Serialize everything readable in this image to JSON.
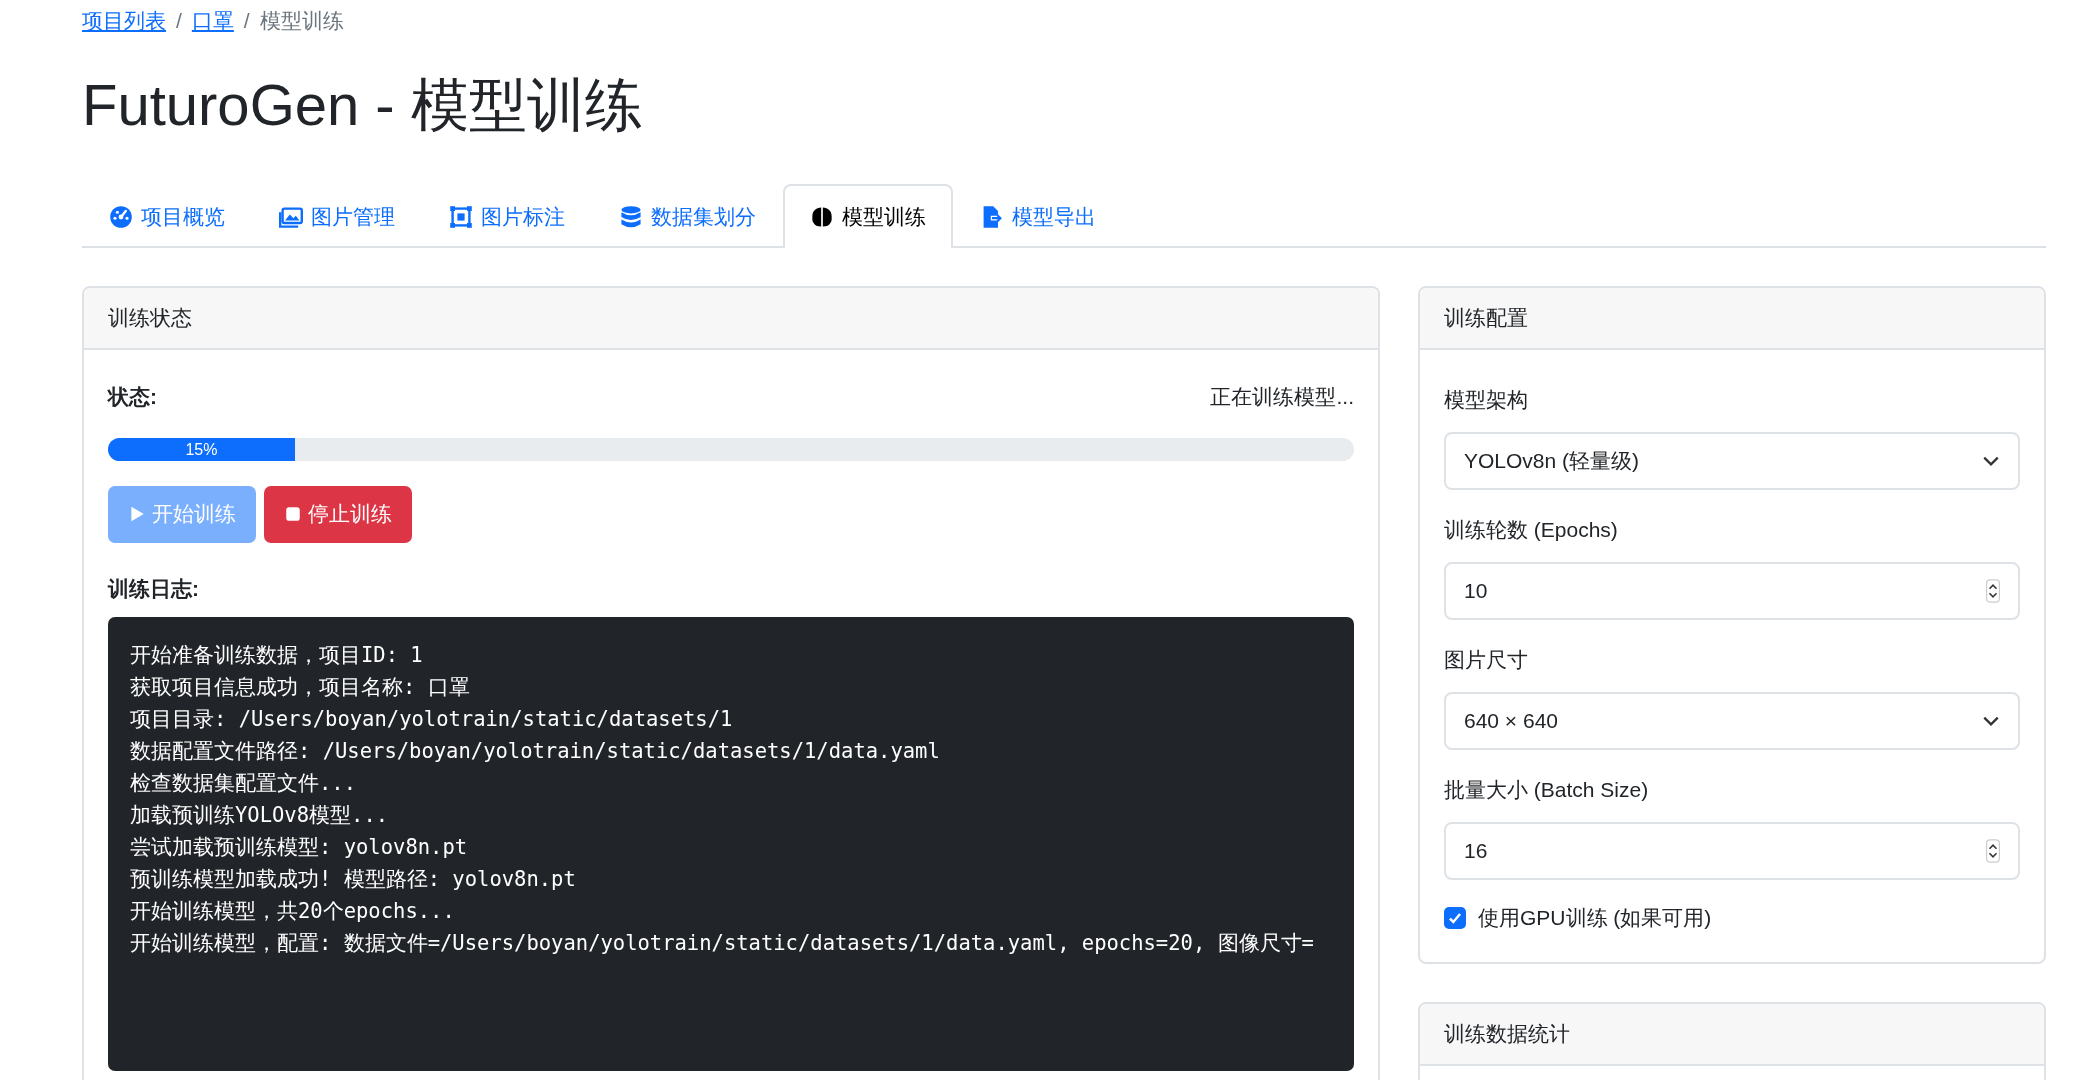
{
  "breadcrumb": [
    {
      "label": "项目列表",
      "kind": "link"
    },
    {
      "label": "口罩",
      "kind": "link",
      "separator": "/"
    },
    {
      "label": "模型训练",
      "kind": "current",
      "separator": "/"
    }
  ],
  "title": "FuturoGen - 模型训练",
  "tabs": [
    {
      "label": "项目概览",
      "selected": false
    },
    {
      "label": "图片管理",
      "selected": false
    },
    {
      "label": "图片标注",
      "selected": false
    },
    {
      "label": "数据集划分",
      "selected": false
    },
    {
      "label": "模型训练",
      "selected": true
    },
    {
      "label": "模型导出",
      "selected": false
    }
  ],
  "training_status": {
    "title": "训练状态",
    "status_label": "状态:",
    "status_value": "正在训练模型...",
    "progress": {
      "level": 0.15,
      "label": "15%"
    },
    "buttons": [
      {
        "label": "开始训练",
        "kind": "start",
        "disabled": true
      },
      {
        "label": "停止训练",
        "kind": "stop",
        "disabled": false
      }
    ],
    "log_label": "训练日志:",
    "log_lines": [
      "开始准备训练数据，项目ID: 1",
      "获取项目信息成功，项目名称: 口罩",
      "项目目录: /Users/boyan/yolotrain/static/datasets/1",
      "数据配置文件路径: /Users/boyan/yolotrain/static/datasets/1/data.yaml",
      "检查数据集配置文件...",
      "加载预训练YOLOv8模型...",
      "尝试加载预训练模型: yolov8n.pt",
      "预训练模型加载成功! 模型路径: yolov8n.pt",
      "开始训练模型，共20个epochs...",
      "开始训练模型，配置: 数据文件=/Users/boyan/yolotrain/static/datasets/1/data.yaml, epochs=20, 图像尺寸="
    ]
  },
  "training_config": {
    "title": "训练配置",
    "fields": [
      {
        "kind": "select",
        "label": "模型架构",
        "value": "YOLOv8n (轻量级)"
      },
      {
        "kind": "number",
        "label": "训练轮数 (Epochs)",
        "value": "10"
      },
      {
        "kind": "select",
        "label": "图片尺寸",
        "value": "640 × 640"
      },
      {
        "kind": "number",
        "label": "批量大小 (Batch Size)",
        "value": "16"
      }
    ],
    "gpu": {
      "label": "使用GPU训练 (如果可用)",
      "checked": true
    }
  },
  "training_stats": {
    "title": "训练数据统计"
  }
}
